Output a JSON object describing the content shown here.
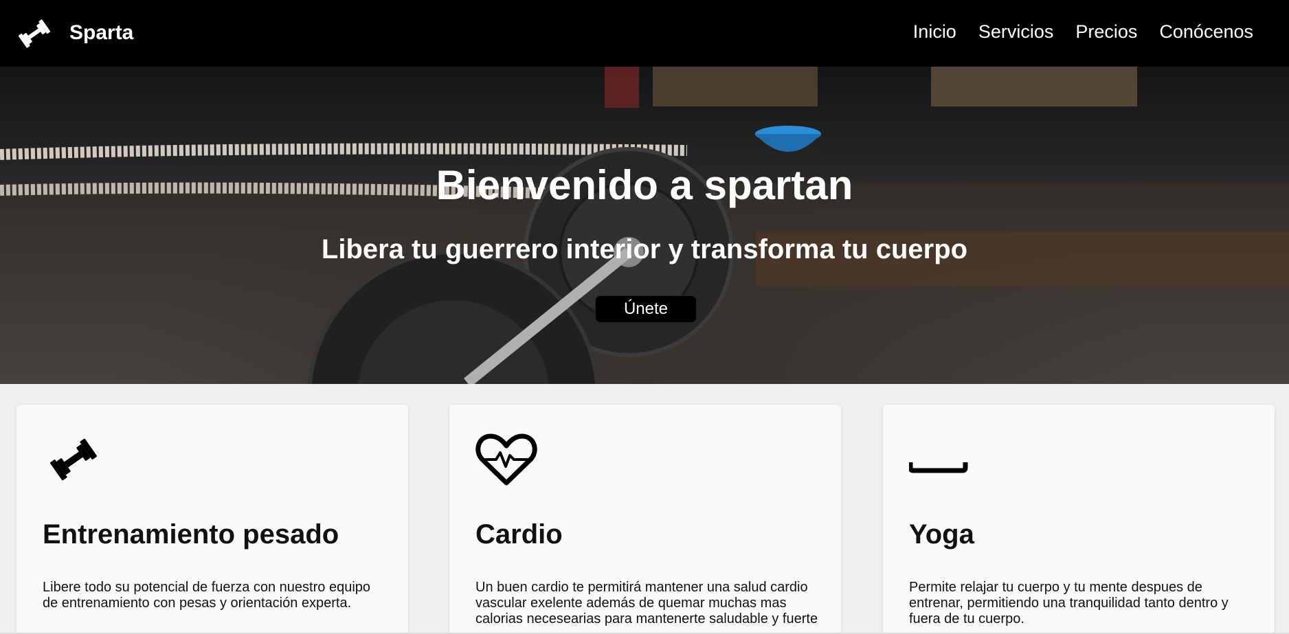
{
  "navbar": {
    "brand": "Sparta",
    "brand_icon": "dumbbell-icon",
    "links": [
      "Inicio",
      "Servicios",
      "Precios",
      "Conócenos"
    ]
  },
  "hero": {
    "title": "Bienvenido a spartan",
    "subtitle": "Libera tu guerrero interior y transforma tu cuerpo",
    "button": "Únete"
  },
  "cards": [
    {
      "icon": "dumbbell-icon",
      "title": "Entrenamiento pesado",
      "text": "Libere todo su potencial de fuerza con nuestro equipo de entrenamiento con pesas y orientación experta."
    },
    {
      "icon": "heartbeat-icon",
      "title": "Cardio",
      "text": "Un buen cardio te permitirá mantener una salud cardio vascular exelente además de quemar muchas mas calorias necesearias para mantenerte saludable y fuerte"
    },
    {
      "icon": "yoga-mat-icon",
      "title": "Yoga",
      "text": "Permite relajar tu cuerpo y tu mente despues de entrenar, permitiendo una tranquilidad tanto dentro y fuera de tu cuerpo."
    }
  ],
  "colors": {
    "navbar_bg": "#000000",
    "page_bg": "#efefef",
    "card_bg": "#fafafa",
    "text": "#111111"
  }
}
